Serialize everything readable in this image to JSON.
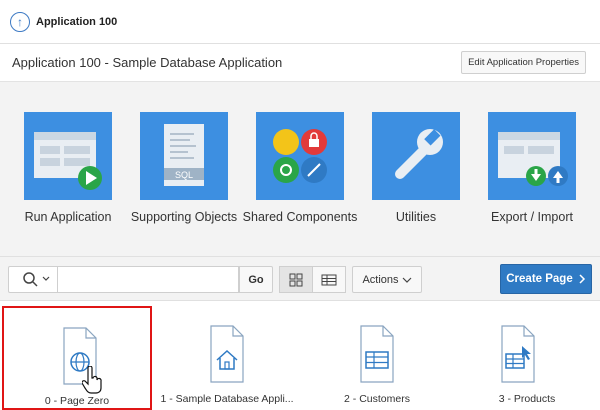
{
  "breadcrumb": {
    "title": "Application 100"
  },
  "header": {
    "title": "Application 100 - Sample Database Application",
    "edit_label": "Edit Application Properties"
  },
  "tiles": [
    {
      "label": "Run Application",
      "icon": "run-application-icon"
    },
    {
      "label": "Supporting Objects",
      "icon": "sql-script-icon",
      "badge": "SQL"
    },
    {
      "label": "Shared Components",
      "icon": "shared-components-icon"
    },
    {
      "label": "Utilities",
      "icon": "wrench-icon"
    },
    {
      "label": "Export / Import",
      "icon": "export-import-icon"
    }
  ],
  "toolbar": {
    "go_label": "Go",
    "actions_label": "Actions",
    "create_label": "Create Page",
    "search_value": ""
  },
  "pages": [
    {
      "label": "0 - Page Zero",
      "icon": "globe-page-icon",
      "selected": true
    },
    {
      "label": "1 - Sample Database Appli...",
      "icon": "home-page-icon"
    },
    {
      "label": "2 - Customers",
      "icon": "table-page-icon"
    },
    {
      "label": "3 - Products",
      "icon": "table-cursor-page-icon"
    }
  ],
  "colors": {
    "tile_blue": "#3d8fe1",
    "accent": "#2f7ac4",
    "selection": "#e01515"
  }
}
